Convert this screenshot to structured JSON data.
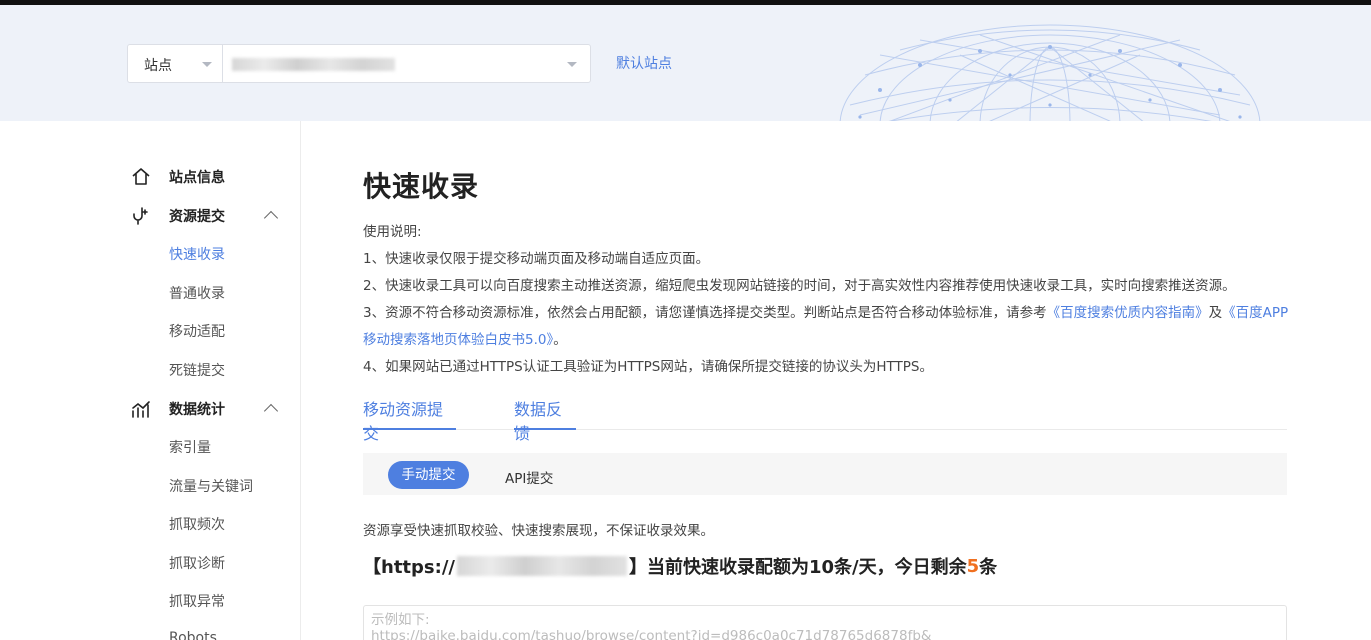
{
  "header": {
    "site_select_label": "站点",
    "default_site_link": "默认站点"
  },
  "sidebar": {
    "groups": [
      {
        "label": "站点信息",
        "icon": "home-icon"
      },
      {
        "label": "资源提交",
        "icon": "submit-hook-icon"
      },
      {
        "label": "数据统计",
        "icon": "stats-chart-icon"
      }
    ],
    "resource_items": [
      "快速收录",
      "普通收录",
      "移动适配",
      "死链提交"
    ],
    "stats_items": [
      "索引量",
      "流量与关键词",
      "抓取频次",
      "抓取诊断",
      "抓取异常",
      "Robots"
    ]
  },
  "main": {
    "title": "快速收录",
    "instructions_heading": "使用说明:",
    "instructions": [
      "1、快速收录仅限于提交移动端页面及移动端自适应页面。",
      "2、快速收录工具可以向百度搜索主动推送资源，缩短爬虫发现网站链接的时间，对于高实效性内容推荐使用快速收录工具，实时向搜索推送资源。"
    ],
    "line3_prefix": "3、资源不符合移动资源标准，依然会占用配额，请您谨慎选择提交类型。判断站点是否符合移动体验标准，请参考",
    "line3_link1": "《百度搜索优质内容指南》",
    "line3_mid": "及",
    "line3_link2_part1": "《百度APP",
    "line3_link2_part2": "移动搜索落地页体验白皮书5.0》",
    "line3_suffix": "。",
    "line4": "4、如果网站已通过HTTPS认证工具验证为HTTPS网站，请确保所提交链接的协议头为HTTPS。",
    "tabs": [
      "移动资源提交",
      "数据反馈"
    ],
    "modes": {
      "manual": "手动提交",
      "api": "API提交"
    },
    "note": "资源享受快速抓取校验、快速搜索展现，不保证收录效果。",
    "quota": {
      "prefix": "【https://",
      "suffix": "】当前快速收录配额为10条/天，今日剩余",
      "remaining": "5",
      "unit": "条"
    },
    "textarea_placeholder_line1": "示例如下:",
    "textarea_placeholder_line2": "https://baike.baidu.com/tashuo/browse/content?id=d986c0a0c71d78765d6878fb&"
  },
  "colors": {
    "accent": "#4e7fe0",
    "highlight": "#f07020",
    "header_bg": "#eef2f9"
  }
}
